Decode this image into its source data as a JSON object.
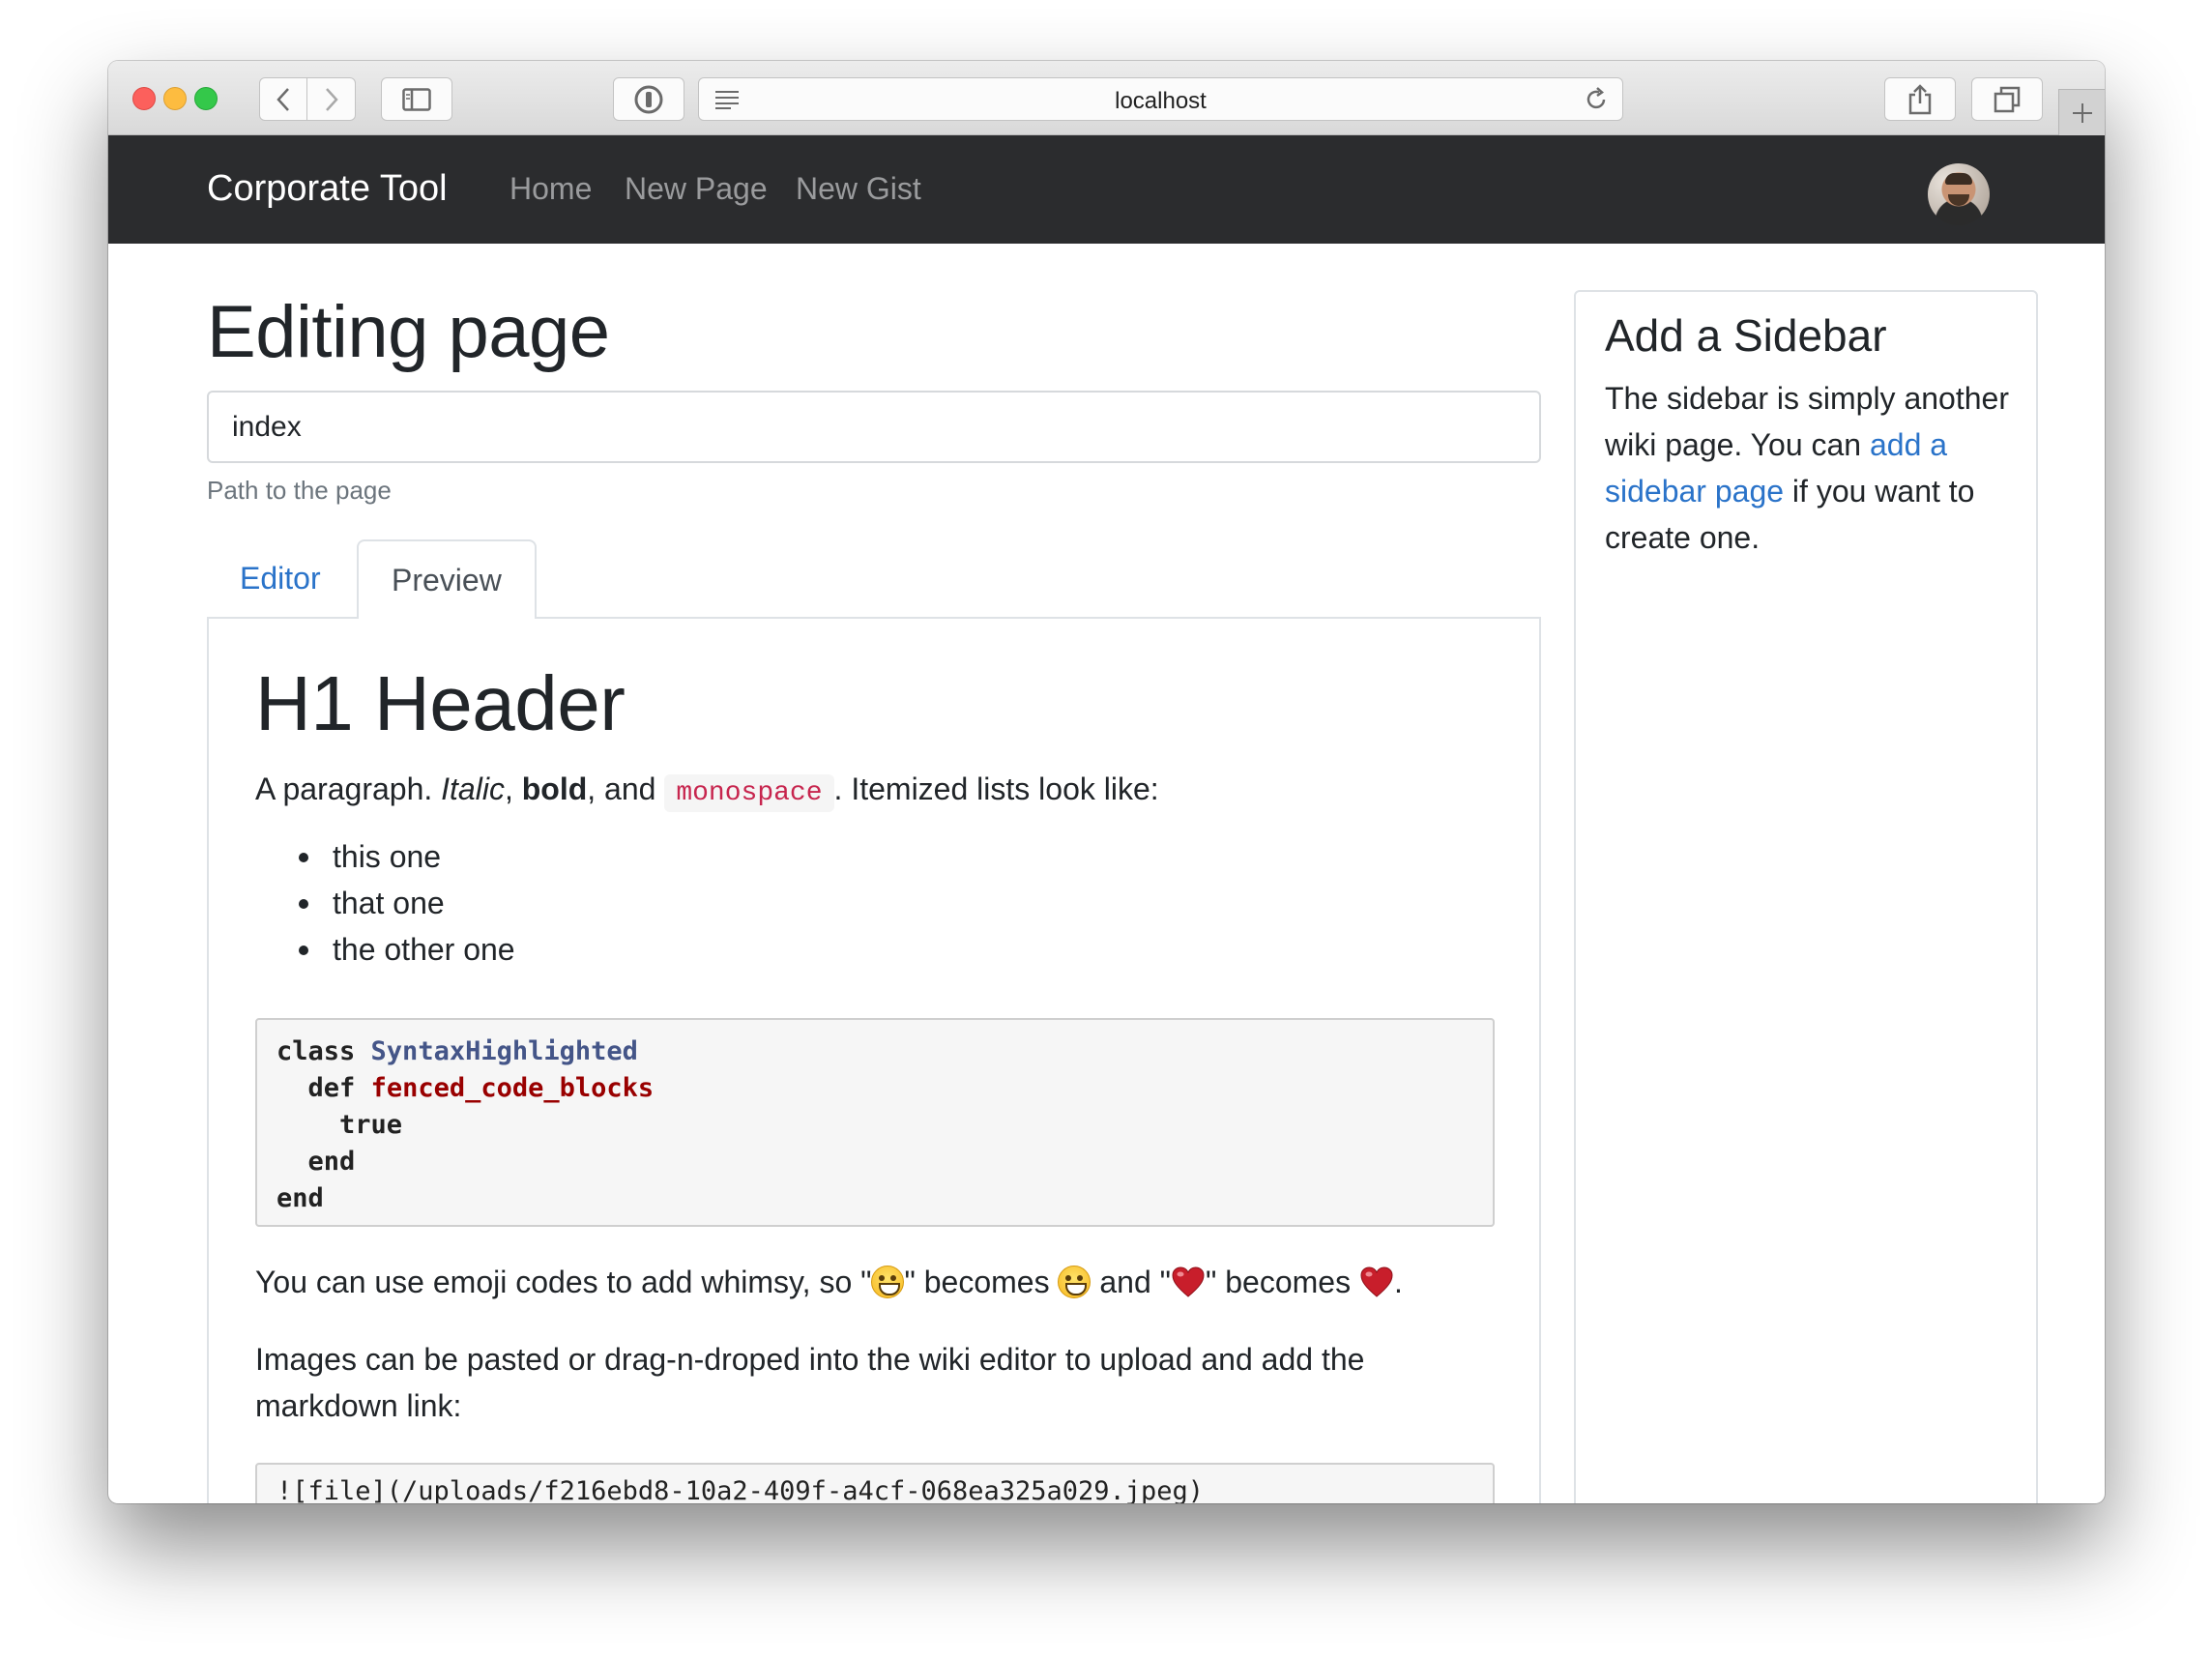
{
  "browser": {
    "url": "localhost"
  },
  "navbar": {
    "brand": "Corporate Tool",
    "links": [
      "Home",
      "New Page",
      "New Gist"
    ]
  },
  "page": {
    "title": "Editing page",
    "path_value": "index",
    "path_help": "Path to the page",
    "tabs": [
      "Editor",
      "Preview"
    ],
    "active_tab": "Preview"
  },
  "preview": {
    "h1": "H1 Header",
    "para1": {
      "start": "A paragraph. ",
      "italic": "Italic",
      "sep1": ", ",
      "bold": "bold",
      "sep2": ", and ",
      "code": "monospace",
      "end": ". Itemized lists look like:"
    },
    "list": [
      "this one",
      "that one",
      "the other one"
    ],
    "code_lines": {
      "l1_kw": "class",
      "l1_name": "SyntaxHighlighted",
      "l2_kw": "def",
      "l2_name": "fenced_code_blocks",
      "l3": "true",
      "l4": "end",
      "l5": "end"
    },
    "emoji_para": {
      "t1": "You can use emoji codes to add whimsy, so \"",
      "t2": "\" becomes ",
      "t3": " and \"",
      "t4": "\" becomes ",
      "t5": "."
    },
    "images_para": "Images can be pasted or drag-n-droped into the wiki editor to upload and add the markdown link:",
    "image_code": "![file](/uploads/f216ebd8-10a2-409f-a4cf-068ea325a029.jpeg)"
  },
  "sidebar": {
    "title": "Add a Sidebar",
    "text_before": "The sidebar is simply another wiki page. You can ",
    "link": "add a sidebar page",
    "text_after": " if you want to create one."
  },
  "colors": {
    "navbar_bg": "#2b2c2e",
    "link": "#2a73c9",
    "inline_code": "#c7254e"
  }
}
